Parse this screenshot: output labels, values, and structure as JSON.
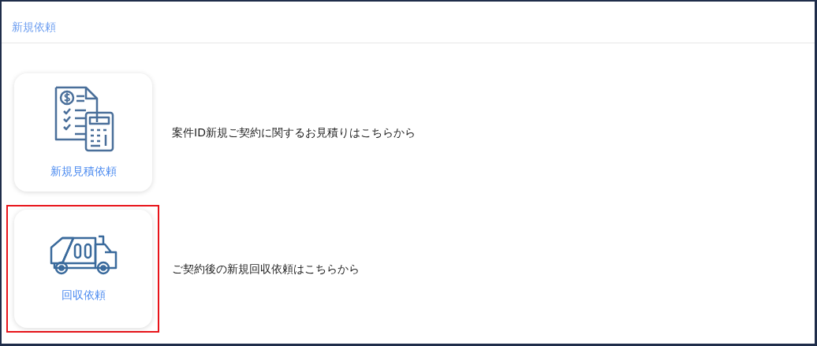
{
  "header": {
    "title": "新規依頼"
  },
  "items": [
    {
      "kind": "estimate",
      "label": "新規見積依頼",
      "description": "案件ID新規ご契約に関するお見積りはこちらから",
      "highlighted": false
    },
    {
      "kind": "truck",
      "label": "回収依頼",
      "description": "ご契約後の新規回収依頼はこちらから",
      "highlighted": true
    }
  ]
}
